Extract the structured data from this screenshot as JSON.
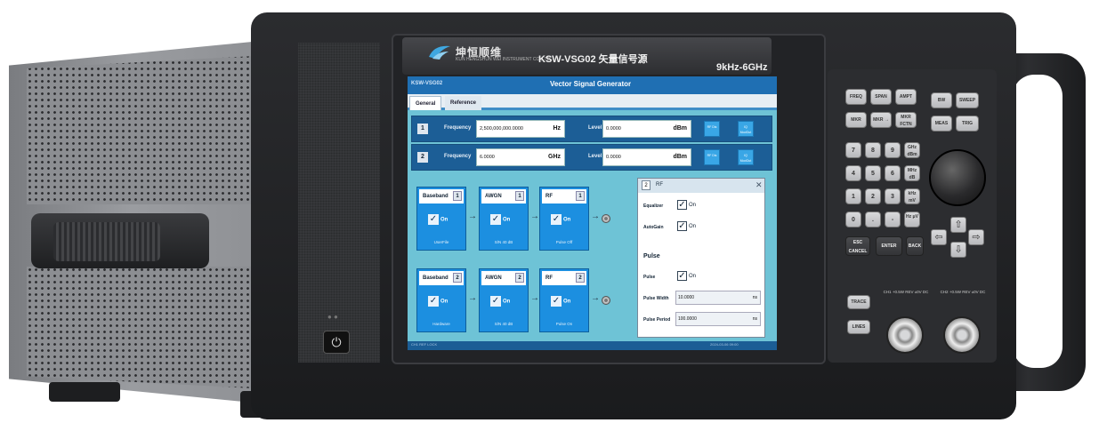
{
  "device": {
    "brand_name": "坤恒顺维",
    "brand_sub": "KUN HENGSHUN WEI INSTRUMENT CO.,LTD",
    "model": "KSW-VSG02 矢量信号源",
    "freq_range": "9kHz-6GHz"
  },
  "app": {
    "tag": "KSW-VSG02",
    "title": "Vector Signal Generator",
    "tabs": [
      "General",
      "Reference"
    ]
  },
  "channels": [
    {
      "num": "1",
      "frequency_label": "Frequency",
      "frequency_value": "2,500,000,000.0000",
      "frequency_unit": "Hz",
      "level_label": "Level",
      "level_value": "0.0000",
      "level_unit": "dBm",
      "btn_rf": "RF Dis",
      "btn_iq": "IQ ModOut"
    },
    {
      "num": "2",
      "frequency_label": "Frequency",
      "frequency_value": "6.0000",
      "frequency_unit": "GHz",
      "level_label": "Level",
      "level_value": "0.0000",
      "level_unit": "dBm",
      "btn_rf": "RF Dis",
      "btn_iq": "IQ ModOut"
    }
  ],
  "chains": [
    {
      "baseband": {
        "label": "Baseband",
        "idx": "1",
        "check": "On",
        "footer": "UserFile"
      },
      "awgn": {
        "label": "AWGN",
        "idx": "1",
        "check": "On",
        "footer": "S/N  40 dB"
      },
      "rf": {
        "label": "RF",
        "idx": "1",
        "check": "On",
        "footer": "Pulse  Off"
      }
    },
    {
      "baseband": {
        "label": "Baseband",
        "idx": "2",
        "check": "On",
        "footer": "Hardware"
      },
      "awgn": {
        "label": "AWGN",
        "idx": "2",
        "check": "On",
        "footer": "S/N  40 dB"
      },
      "rf": {
        "label": "RF",
        "idx": "2",
        "check": "On",
        "footer": "Pulse  On"
      }
    }
  ],
  "rf_panel": {
    "num": "2",
    "title": "RF",
    "equalizer_label": "Equalizer",
    "equalizer_check": "On",
    "autogain_label": "AutoGain",
    "autogain_check": "On",
    "pulse_heading": "Pulse",
    "pulse_label": "Pulse",
    "pulse_check": "On",
    "pulse_width_label": "Pulse Width",
    "pulse_width_value": "10.0000",
    "pulse_width_unit": "ns",
    "pulse_period_label": "Pulse Period",
    "pulse_period_value": "100.0000",
    "pulse_period_unit": "ns"
  },
  "status": {
    "left": "CH1  REF  LOCK",
    "right": "2024-03-06 09:00"
  },
  "keys": {
    "freq": "FREQ",
    "span": "SPAN",
    "ampt": "AMPT",
    "mkr": "MKR",
    "mkr_arrow": "MKR →",
    "mkr_fctn": "MKR FCTN",
    "bw": "BW",
    "sweep": "SWEEP",
    "meas": "MEAS",
    "trig": "TRIG",
    "n7": "7",
    "n8": "8",
    "n9": "9",
    "n4": "4",
    "n5": "5",
    "n6": "6",
    "n1": "1",
    "n2": "2",
    "n3": "3",
    "n0": "0",
    "dot": ".",
    "minus": "-",
    "ghz": "GHz dBm",
    "mhz": "MHz dB",
    "khz": "kHz mV",
    "hz": "Hz μV",
    "esc": "ESC CANCEL",
    "enter": "ENTER",
    "back": "BACK",
    "trace": "TRACE",
    "lines": "LINES"
  },
  "connectors": {
    "ch1": "CH1 +0.5W REV ±0V DC",
    "ch2": "CH2 +0.5W REV ±0V DC"
  },
  "colors": {
    "screen_bg": "#6ec3d6",
    "titlebar": "#1f6fb3",
    "block": "#1c8fe0"
  }
}
